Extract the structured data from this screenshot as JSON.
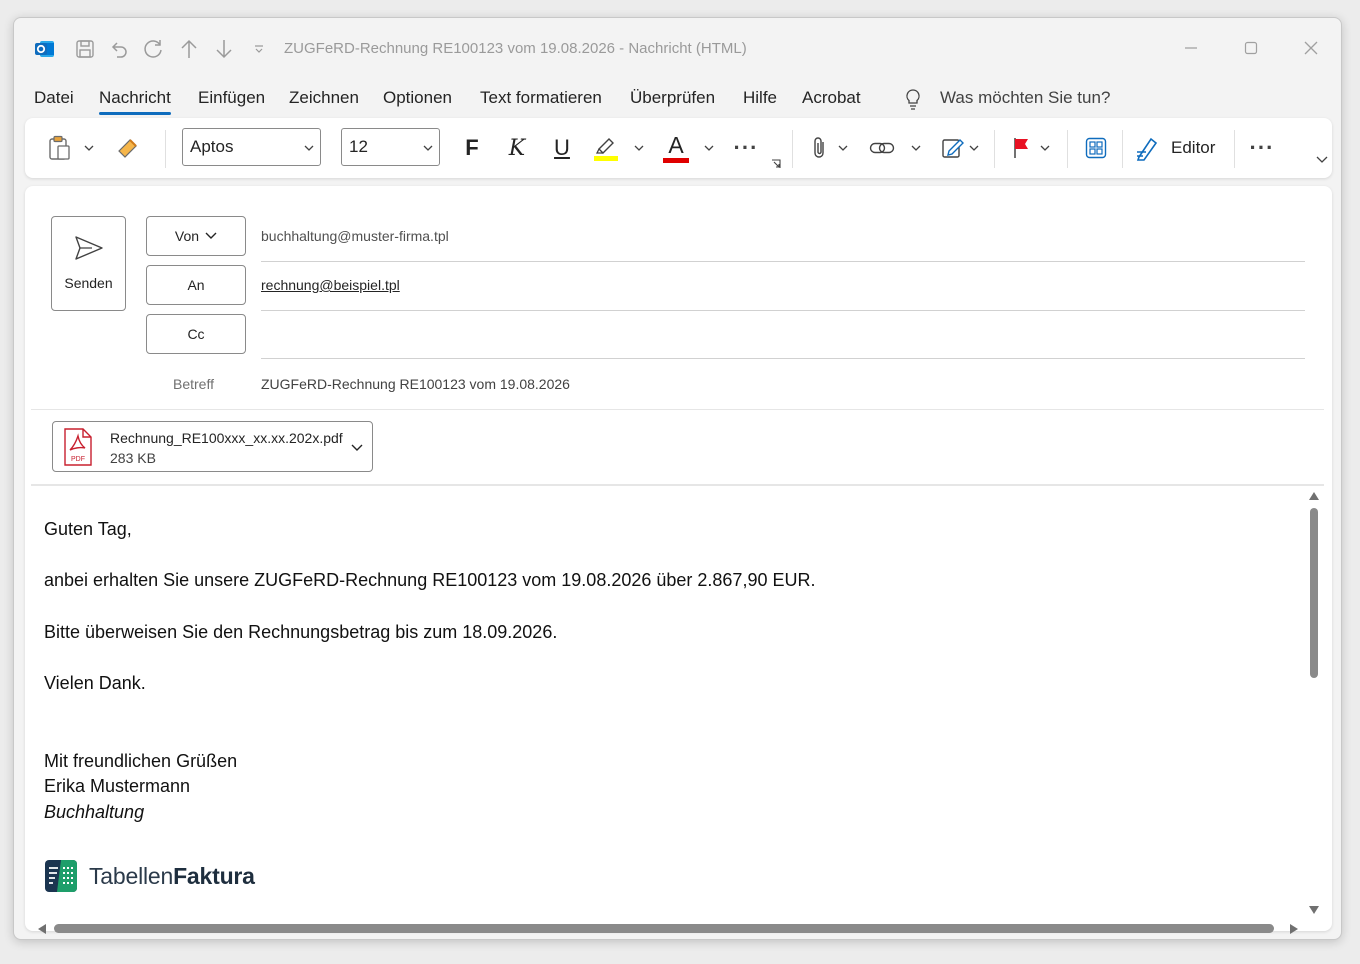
{
  "window": {
    "title": "ZUGFeRD-Rechnung RE100123 vom 19.08.2026  -  Nachricht (HTML)"
  },
  "menu": {
    "items": [
      "Datei",
      "Nachricht",
      "Einfügen",
      "Zeichnen",
      "Optionen",
      "Text formatieren",
      "Überprüfen",
      "Hilfe",
      "Acrobat"
    ],
    "active": "Nachricht",
    "tell_me": "Was möchten Sie tun?"
  },
  "ribbon": {
    "font_name": "Aptos",
    "font_size": "12",
    "bold": "F",
    "italic": "K",
    "underline": "U",
    "font_color_letter": "A",
    "more": "···",
    "editor_label": "Editor",
    "highlight_color": "#ffff00",
    "font_color": "#e00000"
  },
  "compose": {
    "send_label": "Senden",
    "from_label": "Von",
    "from_value": "buchhaltung@muster-firma.tpl",
    "to_label": "An",
    "to_value": "rechnung@beispiel.tpl",
    "cc_label": "Cc",
    "cc_value": "",
    "subject_label": "Betreff",
    "subject_value": "ZUGFeRD-Rechnung RE100123 vom 19.08.2026"
  },
  "attachment": {
    "name": "Rechnung_RE100xxx_xx.xx.202x.pdf",
    "size": "283 KB",
    "type_label": "PDF"
  },
  "body": {
    "greeting": "Guten Tag,",
    "line1": "anbei erhalten Sie unsere ZUGFeRD-Rechnung RE100123 vom 19.08.2026 über 2.867,90 EUR.",
    "line2": "Bitte überweisen Sie den Rechnungsbetrag bis zum 18.09.2026.",
    "thanks": "Vielen Dank.",
    "closing": "Mit freundlichen Grüßen",
    "name": "Erika Mustermann",
    "department": "Buchhaltung",
    "logo_text_light": "Tabellen",
    "logo_text_bold": "Faktura"
  },
  "colors": {
    "accent": "#0f6cbd",
    "outlook_blue": "#0f6cbd",
    "flag_red": "#e81123",
    "logo_green": "#1e9e6a",
    "logo_dark": "#1b3550"
  },
  "icons": [
    "outlook-icon",
    "save-icon",
    "undo-icon",
    "redo-icon",
    "up-arrow-icon",
    "down-arrow-icon",
    "customize-icon",
    "paste-icon",
    "format-painter-icon",
    "highlight-icon",
    "font-color-icon",
    "attach-icon",
    "link-icon",
    "signature-icon",
    "flag-icon",
    "apps-icon",
    "editor-icon",
    "send-icon",
    "pdf-icon",
    "lightbulb-icon"
  ]
}
